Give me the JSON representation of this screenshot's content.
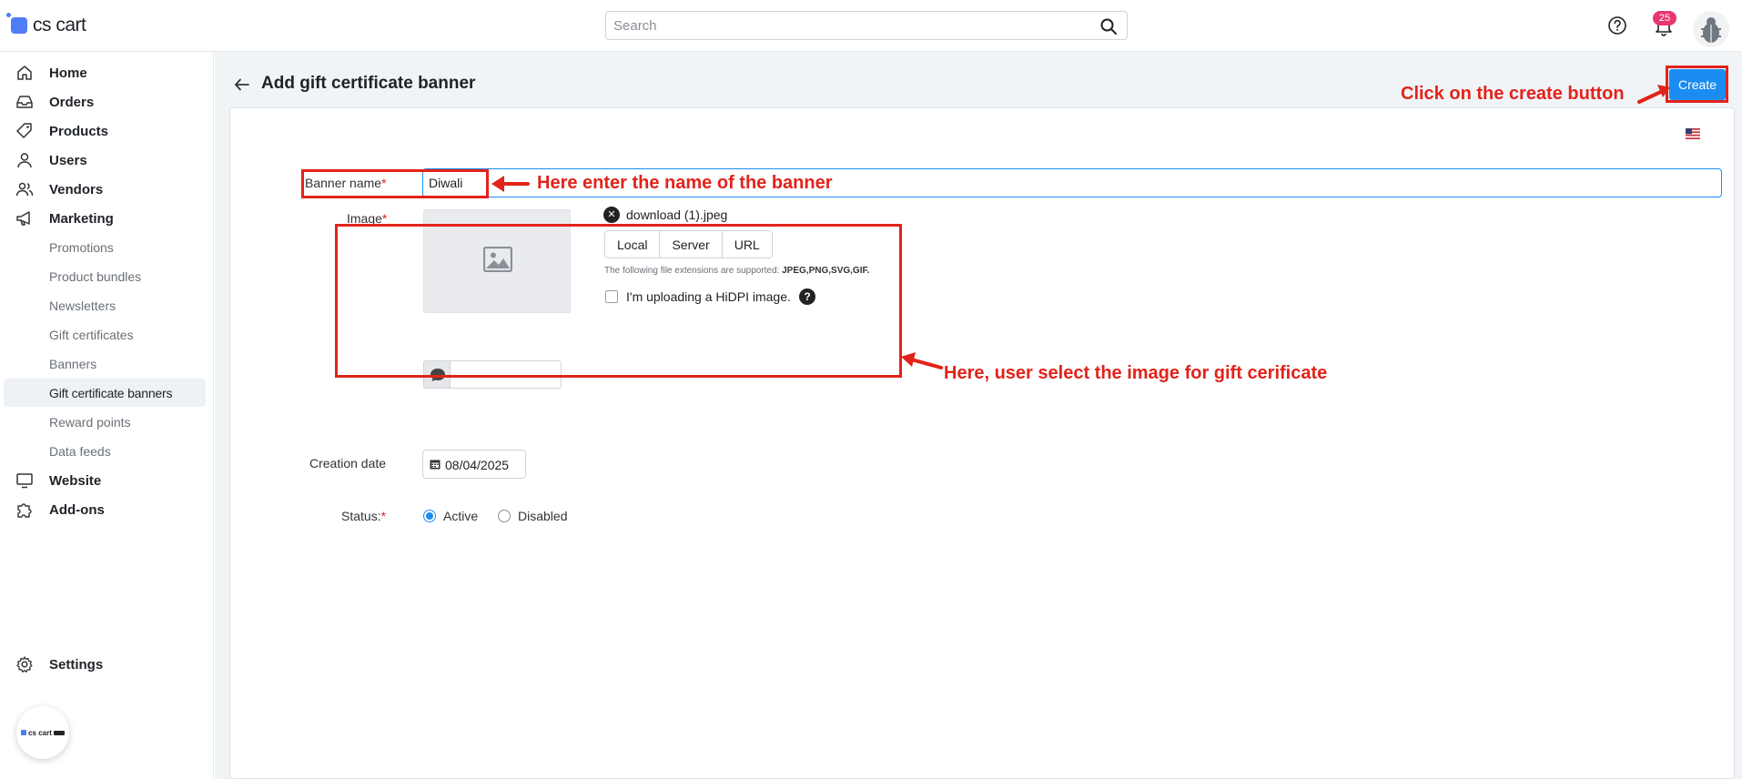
{
  "app": {
    "logo_text": "cs cart",
    "bottom_logo_text": "cs cart"
  },
  "search": {
    "placeholder": "Search"
  },
  "notifications": {
    "count": "25"
  },
  "sidebar": {
    "items": [
      {
        "label": "Home",
        "icon": "home-icon"
      },
      {
        "label": "Orders",
        "icon": "inbox-icon"
      },
      {
        "label": "Products",
        "icon": "tag-icon"
      },
      {
        "label": "Users",
        "icon": "user-icon"
      },
      {
        "label": "Vendors",
        "icon": "users-icon"
      },
      {
        "label": "Marketing",
        "icon": "megaphone-icon"
      }
    ],
    "marketing_sub": [
      {
        "label": "Promotions"
      },
      {
        "label": "Product bundles"
      },
      {
        "label": "Newsletters"
      },
      {
        "label": "Gift certificates"
      },
      {
        "label": "Banners"
      },
      {
        "label": "Gift certificate banners",
        "active": true
      },
      {
        "label": "Reward points"
      },
      {
        "label": "Data feeds"
      }
    ],
    "items_after": [
      {
        "label": "Website",
        "icon": "monitor-icon"
      },
      {
        "label": "Add-ons",
        "icon": "puzzle-icon"
      }
    ],
    "settings": {
      "label": "Settings",
      "icon": "gear-icon"
    }
  },
  "page": {
    "title": "Add gift certificate banner",
    "create_label": "Create"
  },
  "form": {
    "banner_name": {
      "label": "Banner name",
      "required_mark": "*",
      "value": "Diwali"
    },
    "image": {
      "label": "Image",
      "required_mark": "*",
      "file_name": "download (1).jpeg",
      "sources": [
        "Local",
        "Server",
        "URL"
      ],
      "hint_prefix": "The following file extensions are supported: ",
      "hint_exts": "JPEG,PNG,SVG,GIF.",
      "hidpi_label": "I'm uploading a HiDPI image.",
      "help_mark": "?"
    },
    "creation_date": {
      "label": "Creation date",
      "value": "08/04/2025"
    },
    "status": {
      "label": "Status:",
      "required_mark": "*",
      "options": [
        "Active",
        "Disabled"
      ],
      "selected": "Active"
    }
  },
  "annotations": {
    "create": "Click on the create button",
    "name": "Here enter the name of the banner",
    "image": "Here, user select the image for gift cerificate"
  },
  "colors": {
    "accent": "#1b8df2",
    "annotation": "#e2231a",
    "badge": "#e8366e"
  }
}
